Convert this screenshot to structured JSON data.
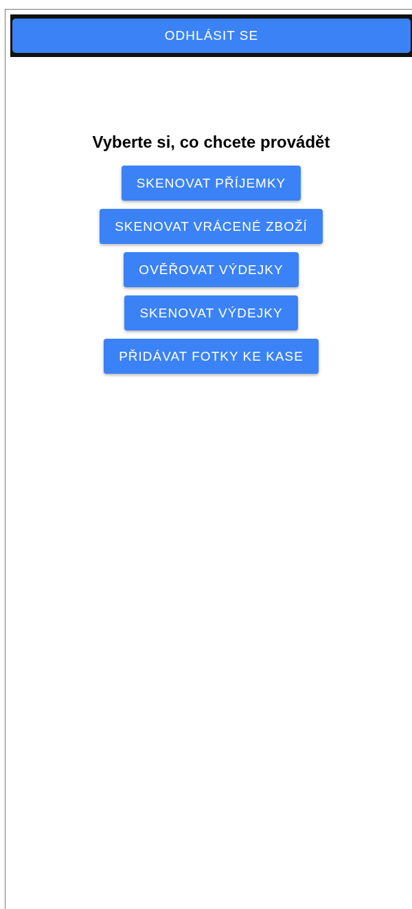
{
  "logout_button": {
    "label": "ODHLÁSIT SE"
  },
  "heading": "Vyberte si, co chcete provádět",
  "actions": [
    {
      "label": "SKENOVAT PŘÍJEMKY"
    },
    {
      "label": "SKENOVAT VRÁCENÉ ZBOŽÍ"
    },
    {
      "label": "OVĚŘOVAT VÝDEJKY"
    },
    {
      "label": "SKENOVAT VÝDEJKY"
    },
    {
      "label": "PŘIDÁVAT FOTKY KE KASE"
    }
  ]
}
